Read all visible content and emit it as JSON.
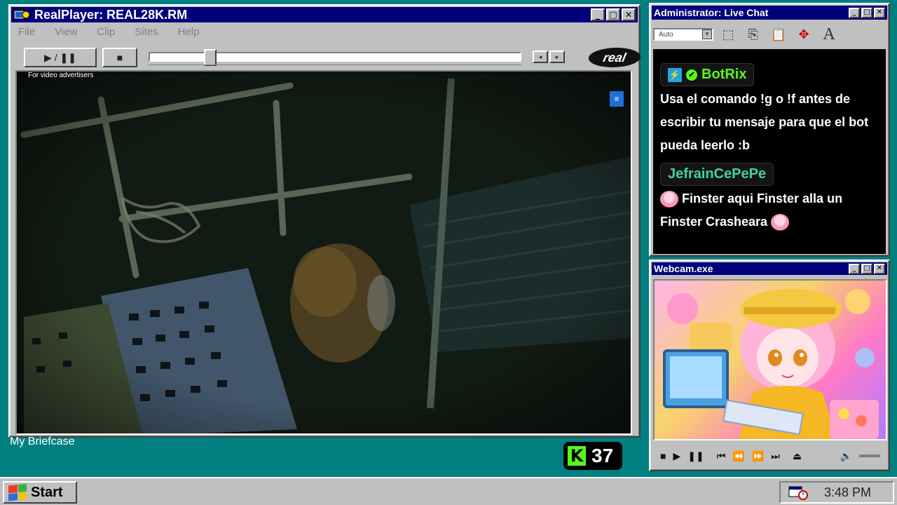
{
  "player": {
    "title": "RealPlayer: REAL28K.RM",
    "menu": [
      "File",
      "View",
      "Clip",
      "Sites",
      "Help"
    ],
    "play_pause_label": "▶ / ❚❚",
    "stop_label": "■",
    "logo_text": "real",
    "seek_fraction": 0.15,
    "ad_text": "For video advertisers",
    "menu_icon": "≡"
  },
  "desktop": {
    "briefcase_label": "My Briefcase",
    "viewer_count": "37",
    "kick_letter": "K"
  },
  "chat": {
    "title": "Administrator: Live Chat",
    "font_combo": "Auto",
    "partial_top": "...",
    "messages": [
      {
        "user": "BotRix",
        "user_color": "#53fc18",
        "text": "Usa el comando !g o !f antes de escribir tu mensaje para que el bot pueda leerlo :b"
      },
      {
        "user": "JefrainCePePe",
        "user_color": "#3fd69a",
        "text": "Finster aqui Finster alla un Finster Crasheara"
      }
    ]
  },
  "webcam": {
    "title": "Webcam.exe"
  },
  "taskbar": {
    "start_label": "Start",
    "clock": "3:48 PM"
  },
  "colors": {
    "desktop": "#008080",
    "titlebar": "#00007b",
    "kick_green": "#53fc18"
  }
}
